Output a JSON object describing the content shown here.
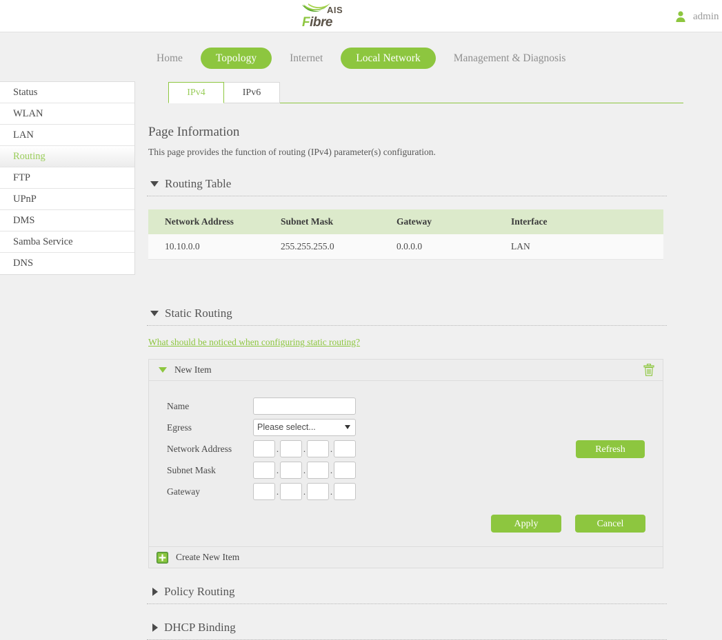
{
  "header": {
    "logo_ais": "AIS",
    "logo_fibre_accent": "F",
    "logo_fibre_rest": "ibre",
    "user_icon": "user-icon",
    "user_name": "admin",
    "brand_green": "#8dc63f"
  },
  "nav": {
    "items": [
      {
        "label": "Home",
        "active": false
      },
      {
        "label": "Topology",
        "active": true
      },
      {
        "label": "Internet",
        "active": false
      },
      {
        "label": "Local Network",
        "active": true
      },
      {
        "label": "Management & Diagnosis",
        "active": false
      }
    ]
  },
  "sidebar": {
    "items": [
      {
        "label": "Status",
        "active": false
      },
      {
        "label": "WLAN",
        "active": false
      },
      {
        "label": "LAN",
        "active": false
      },
      {
        "label": "Routing",
        "active": true
      },
      {
        "label": "FTP",
        "active": false
      },
      {
        "label": "UPnP",
        "active": false
      },
      {
        "label": "DMS",
        "active": false
      },
      {
        "label": "Samba Service",
        "active": false
      },
      {
        "label": "DNS",
        "active": false
      }
    ]
  },
  "tabs": [
    {
      "label": "IPv4",
      "active": true
    },
    {
      "label": "IPv6",
      "active": false
    }
  ],
  "page_information": {
    "title": "Page Information",
    "description": "This page provides the function of routing (IPv4) parameter(s) configuration."
  },
  "routing_table": {
    "section_title": "Routing Table",
    "expanded": true,
    "columns": [
      "Network Address",
      "Subnet Mask",
      "Gateway",
      "Interface"
    ],
    "rows": [
      [
        "10.10.0.0",
        "255.255.255.0",
        "0.0.0.0",
        "LAN"
      ]
    ],
    "refresh_label": "Refresh"
  },
  "static_routing": {
    "section_title": "Static Routing",
    "expanded": true,
    "note_link": "What should be noticed when configuring static routing?",
    "panel": {
      "title": "New Item",
      "expanded": true,
      "delete_icon": "trash-icon",
      "fields": {
        "name_label": "Name",
        "name_value": "",
        "name_placeholder": "",
        "egress_label": "Egress",
        "egress_value": "Please select...",
        "network_address_label": "Network Address",
        "network_address_octets": [
          "",
          "",
          "",
          ""
        ],
        "subnet_mask_label": "Subnet Mask",
        "subnet_mask_octets": [
          "",
          "",
          "",
          ""
        ],
        "gateway_label": "Gateway",
        "gateway_octets": [
          "",
          "",
          "",
          ""
        ]
      },
      "apply_label": "Apply",
      "cancel_label": "Cancel"
    },
    "create_new_label": "Create New Item",
    "create_new_icon": "plus-icon"
  },
  "policy_routing": {
    "section_title": "Policy Routing",
    "expanded": false
  },
  "dhcp_binding": {
    "section_title": "DHCP Binding",
    "expanded": false
  }
}
